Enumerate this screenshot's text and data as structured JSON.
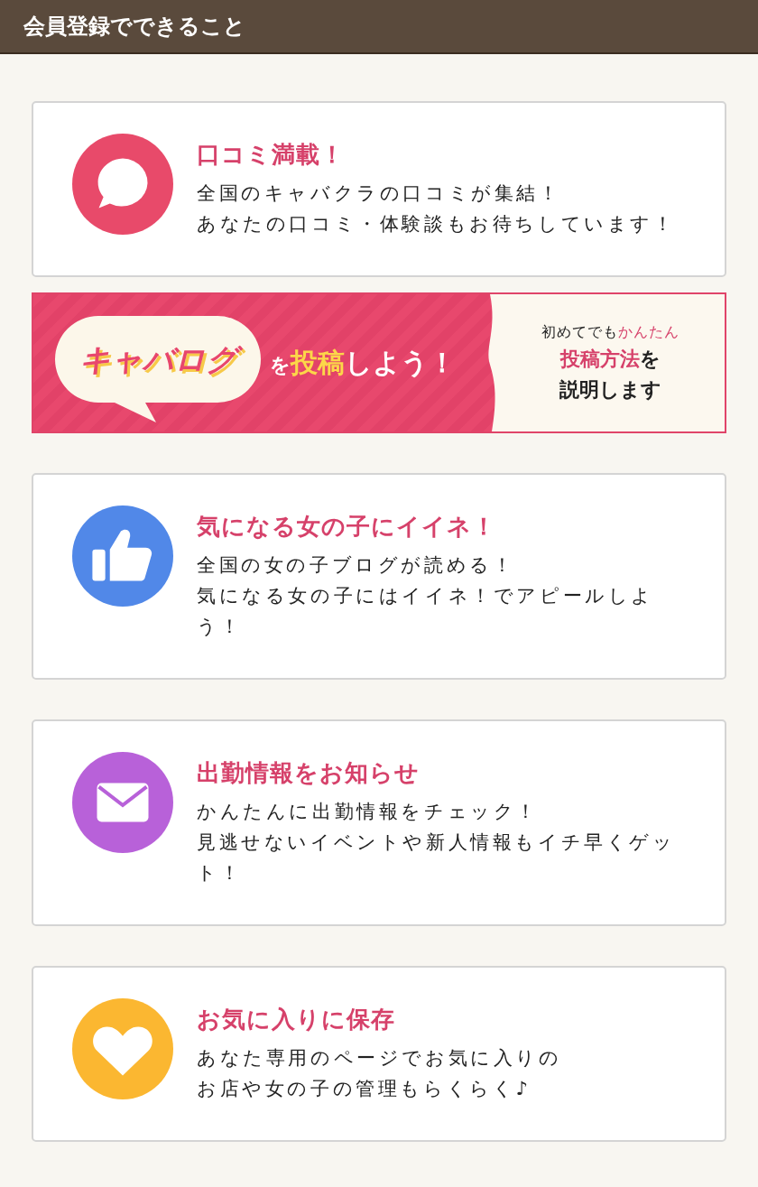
{
  "header": {
    "title": "会員登録でできること"
  },
  "features": [
    {
      "kind": "chat",
      "color": "#e84a6a",
      "title": "口コミ満載！",
      "body": [
        "全国のキャバクラの口コミが集結！",
        "あなたの口コミ・体験談もお待ちしています！"
      ]
    },
    {
      "kind": "thumb",
      "color": "#5188e8",
      "title": "気になる女の子にイイネ！",
      "body": [
        "全国の女の子ブログが読める！",
        "気になる女の子にはイイネ！でアピールしよう！"
      ]
    },
    {
      "kind": "mail",
      "color": "#b861d9",
      "title": "出勤情報をお知らせ",
      "body": [
        "かんたんに出勤情報をチェック！",
        "見逃せないイベントや新人情報もイチ早くゲット！"
      ]
    },
    {
      "kind": "heart",
      "color": "#fbb731",
      "title": "お気に入りに保存",
      "body": [
        "あなた専用のページでお気に入りの",
        "お店や女の子の管理もらくらく♪"
      ]
    }
  ],
  "banner": {
    "logo": "キャバログ",
    "headline": [
      {
        "text": "を",
        "highlight": false
      },
      {
        "text": "投稿",
        "highlight": true
      },
      {
        "text": "しよう！",
        "highlight": false
      }
    ],
    "lines": [
      [
        {
          "text": "初めてでも",
          "highlight": false
        },
        {
          "text": "かんたん",
          "highlight": true
        }
      ],
      [
        {
          "text": "投稿方法",
          "highlight": true
        },
        {
          "text": "を",
          "highlight": false
        }
      ],
      [
        {
          "text": "説明します",
          "highlight": false
        }
      ]
    ]
  }
}
